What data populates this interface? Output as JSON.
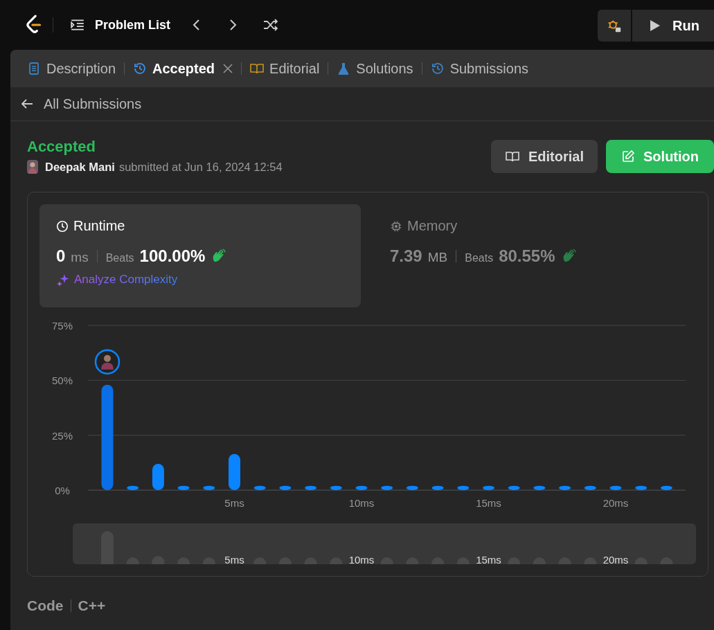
{
  "top_bar": {
    "problem_list": "Problem List",
    "run_button": "Run"
  },
  "tabs": [
    {
      "label": "Description",
      "selected": false,
      "closable": false
    },
    {
      "label": "Accepted",
      "selected": true,
      "closable": true
    },
    {
      "label": "Editorial",
      "selected": false,
      "closable": false
    },
    {
      "label": "Solutions",
      "selected": false,
      "closable": false
    },
    {
      "label": "Submissions",
      "selected": false,
      "closable": false
    }
  ],
  "back_link": "All Submissions",
  "submission": {
    "status": "Accepted",
    "author": "Deepak Mani",
    "submitted_text": "submitted at Jun 16, 2024 12:54",
    "buttons": [
      {
        "label": "Editorial",
        "kind": "secondary"
      },
      {
        "label": "Solution",
        "kind": "primary"
      }
    ]
  },
  "metrics": [
    {
      "title": "Runtime",
      "selected": true,
      "value": "0",
      "unit": "ms",
      "beats_label": "Beats",
      "beats": "100.00%",
      "action": "Analyze Complexity"
    },
    {
      "title": "Memory",
      "selected": false,
      "value": "7.39",
      "unit": "MB",
      "beats_label": "Beats",
      "beats": "80.55%"
    }
  ],
  "chart_data": {
    "type": "bar",
    "x": [
      0,
      1,
      2,
      3,
      4,
      5,
      6,
      7,
      8,
      9,
      10,
      11,
      12,
      13,
      14,
      15,
      16,
      17,
      18,
      19,
      20,
      21,
      22
    ],
    "values": [
      48,
      2,
      12,
      2,
      2,
      16.5,
      2,
      2,
      2,
      2,
      2,
      2,
      2,
      2,
      2,
      2,
      2,
      2,
      2,
      2,
      2,
      2,
      2
    ],
    "xlim": [
      -0.75,
      22.75
    ],
    "ylim": [
      0,
      75
    ],
    "yticks": [
      {
        "value": 0,
        "label": "0%"
      },
      {
        "value": 25,
        "label": "25%"
      },
      {
        "value": 50,
        "label": "50%"
      },
      {
        "value": 75,
        "label": "75%"
      }
    ],
    "xticks": [
      {
        "value": 5,
        "label": "5ms"
      },
      {
        "value": 10,
        "label": "10ms"
      },
      {
        "value": 15,
        "label": "15ms"
      },
      {
        "value": 20,
        "label": "20ms"
      }
    ]
  },
  "overview_ticks": [
    "5ms",
    "10ms",
    "15ms",
    "20ms"
  ],
  "code": {
    "label": "Code",
    "language": "C++"
  }
}
